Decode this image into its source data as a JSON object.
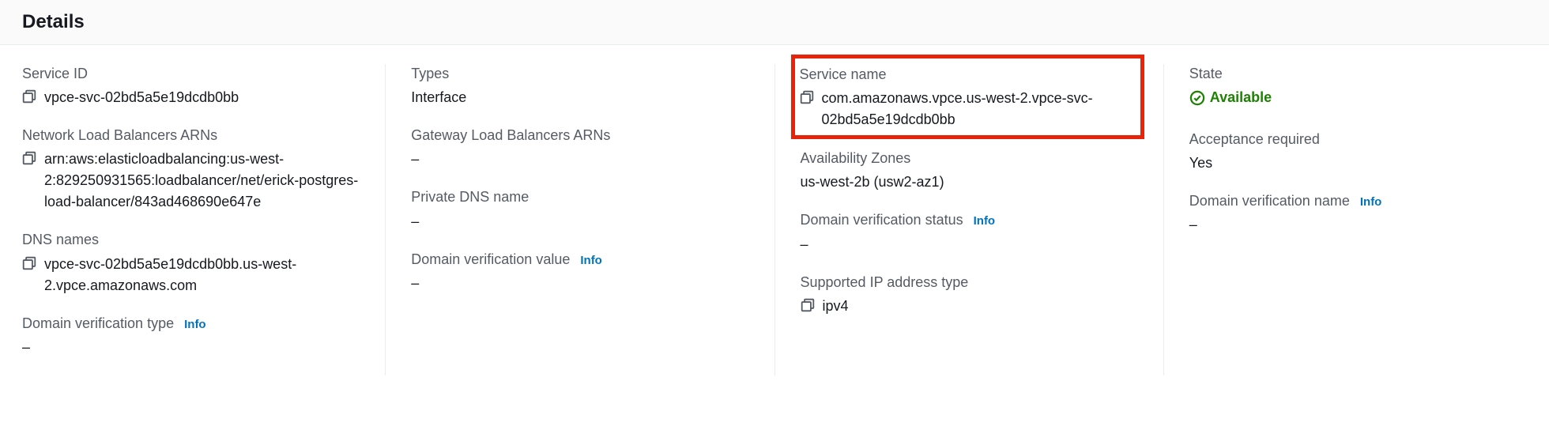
{
  "header": {
    "title": "Details"
  },
  "col1": {
    "serviceId": {
      "label": "Service ID",
      "value": "vpce-svc-02bd5a5e19dcdb0bb"
    },
    "nlbArns": {
      "label": "Network Load Balancers ARNs",
      "value": "arn:aws:elasticloadbalancing:us-west-2:829250931565:loadbalancer/net/erick-postgres-load-balancer/843ad468690e647e"
    },
    "dnsNames": {
      "label": "DNS names",
      "value": "vpce-svc-02bd5a5e19dcdb0bb.us-west-2.vpce.amazonaws.com"
    },
    "domainVerificationType": {
      "label": "Domain verification type",
      "info": "Info",
      "value": "–"
    }
  },
  "col2": {
    "types": {
      "label": "Types",
      "value": "Interface"
    },
    "glbArns": {
      "label": "Gateway Load Balancers ARNs",
      "value": "–"
    },
    "privateDns": {
      "label": "Private DNS name",
      "value": "–"
    },
    "domainVerificationValue": {
      "label": "Domain verification value",
      "info": "Info",
      "value": "–"
    }
  },
  "col3": {
    "serviceName": {
      "label": "Service name",
      "value": "com.amazonaws.vpce.us-west-2.vpce-svc-02bd5a5e19dcdb0bb"
    },
    "az": {
      "label": "Availability Zones",
      "value": "us-west-2b (usw2-az1)"
    },
    "domainVerificationStatus": {
      "label": "Domain verification status",
      "info": "Info",
      "value": "–"
    },
    "ipType": {
      "label": "Supported IP address type",
      "value": "ipv4"
    }
  },
  "col4": {
    "state": {
      "label": "State",
      "value": "Available"
    },
    "acceptance": {
      "label": "Acceptance required",
      "value": "Yes"
    },
    "domainVerificationName": {
      "label": "Domain verification name",
      "info": "Info",
      "value": "–"
    }
  }
}
